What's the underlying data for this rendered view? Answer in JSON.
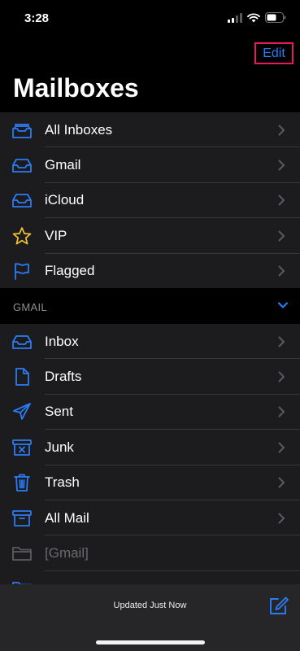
{
  "status_bar": {
    "time": "3:28"
  },
  "nav": {
    "edit_label": "Edit",
    "title": "Mailboxes"
  },
  "smart_mailboxes": [
    {
      "label": "All Inboxes",
      "icon": "all-inboxes-icon"
    },
    {
      "label": "Gmail",
      "icon": "inbox-icon"
    },
    {
      "label": "iCloud",
      "icon": "inbox-icon"
    },
    {
      "label": "VIP",
      "icon": "star-icon"
    },
    {
      "label": "Flagged",
      "icon": "flag-icon"
    }
  ],
  "account_section": {
    "title": "GMAIL",
    "items": [
      {
        "label": "Inbox",
        "icon": "inbox-icon"
      },
      {
        "label": "Drafts",
        "icon": "document-icon"
      },
      {
        "label": "Sent",
        "icon": "paper-plane-icon"
      },
      {
        "label": "Junk",
        "icon": "junk-bin-icon"
      },
      {
        "label": "Trash",
        "icon": "trash-icon"
      },
      {
        "label": "All Mail",
        "icon": "archive-icon"
      },
      {
        "label": "[Gmail]",
        "icon": "folder-icon"
      }
    ]
  },
  "toolbar": {
    "status": "Updated Just Now"
  },
  "colors": {
    "accent": "#2a7cf6",
    "star": "#f2c02e",
    "highlight": "#e8195d"
  }
}
